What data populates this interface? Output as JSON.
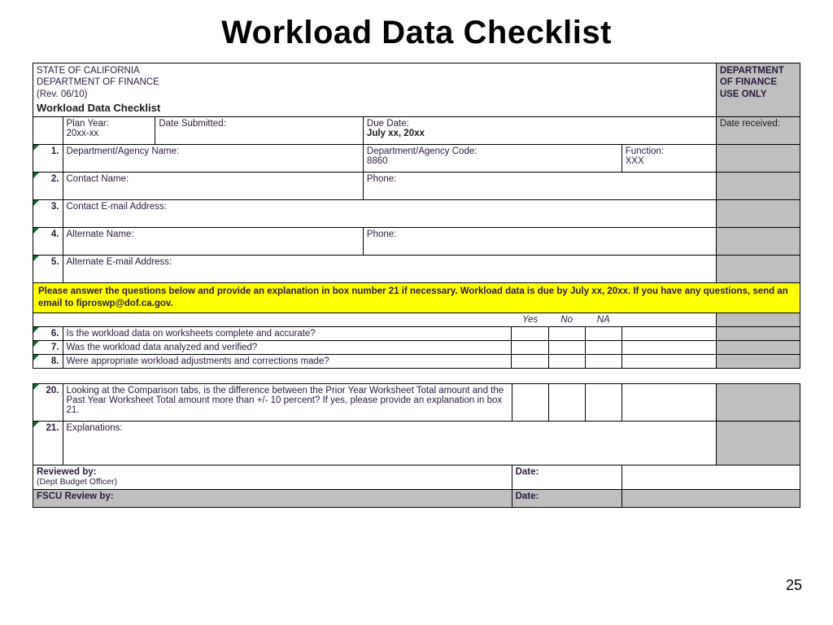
{
  "title": "Workload Data Checklist",
  "header": {
    "line1": "STATE OF CALIFORNIA",
    "line2": "DEPARTMENT OF FINANCE",
    "line3": "(Rev. 06/10)",
    "formTitle": "Workload Data Checklist",
    "useOnly1": "DEPARTMENT",
    "useOnly2": "OF FINANCE",
    "useOnly3": "USE ONLY"
  },
  "row_plan": {
    "planYearLabel": "Plan Year:",
    "planYearValue": "20xx-xx",
    "dateSubmittedLabel": "Date Submitted:",
    "dueDateLabel": "Due Date:",
    "dueDateValue": "July xx, 20xx",
    "dateReceivedLabel": "Date received:"
  },
  "rows": {
    "r1": {
      "n": "1.",
      "deptLabel": "Department/Agency Name:",
      "codeLabel": "Department/Agency Code:",
      "codeValue": "8860",
      "funcLabel": "Function:",
      "funcValue": "XXX"
    },
    "r2": {
      "n": "2.",
      "contactLabel": "Contact Name:",
      "phoneLabel": "Phone:"
    },
    "r3": {
      "n": "3.",
      "emailLabel": "Contact E-mail Address:"
    },
    "r4": {
      "n": "4.",
      "altLabel": "Alternate Name:",
      "phoneLabel": "Phone:"
    },
    "r5": {
      "n": "5.",
      "altEmailLabel": "Alternate E-mail Address:"
    }
  },
  "instructions": "Please answer the questions below and provide an explanation in box number 21 if necessary.  Workload data is due by July xx, 20xx.  If you have any questions, send an email to fiproswp@dof.ca.gov.",
  "yn": {
    "yes": "Yes",
    "no": "No",
    "na": "NA"
  },
  "q": {
    "q6": {
      "n": "6.",
      "text": "Is the workload data on worksheets complete and accurate?"
    },
    "q7": {
      "n": "7.",
      "text": "Was the workload data analyzed and verified?"
    },
    "q8": {
      "n": "8.",
      "text": "Were appropriate workload adjustments and corrections made?"
    },
    "q20": {
      "n": "20.",
      "text": "Looking at the Comparison tabs, is the difference between the Prior Year Worksheet Total amount and the Past Year Worksheet Total amount more than +/- 10 percent?  If yes, please provide an explanation in box 21."
    },
    "q21": {
      "n": "21.",
      "text": "Explanations:"
    }
  },
  "sig": {
    "reviewed": "Reviewed by:",
    "reviewedSub": "(Dept Budget Officer)",
    "fscu": "FSCU Review by:",
    "date": "Date:"
  },
  "pageNumber": "25"
}
